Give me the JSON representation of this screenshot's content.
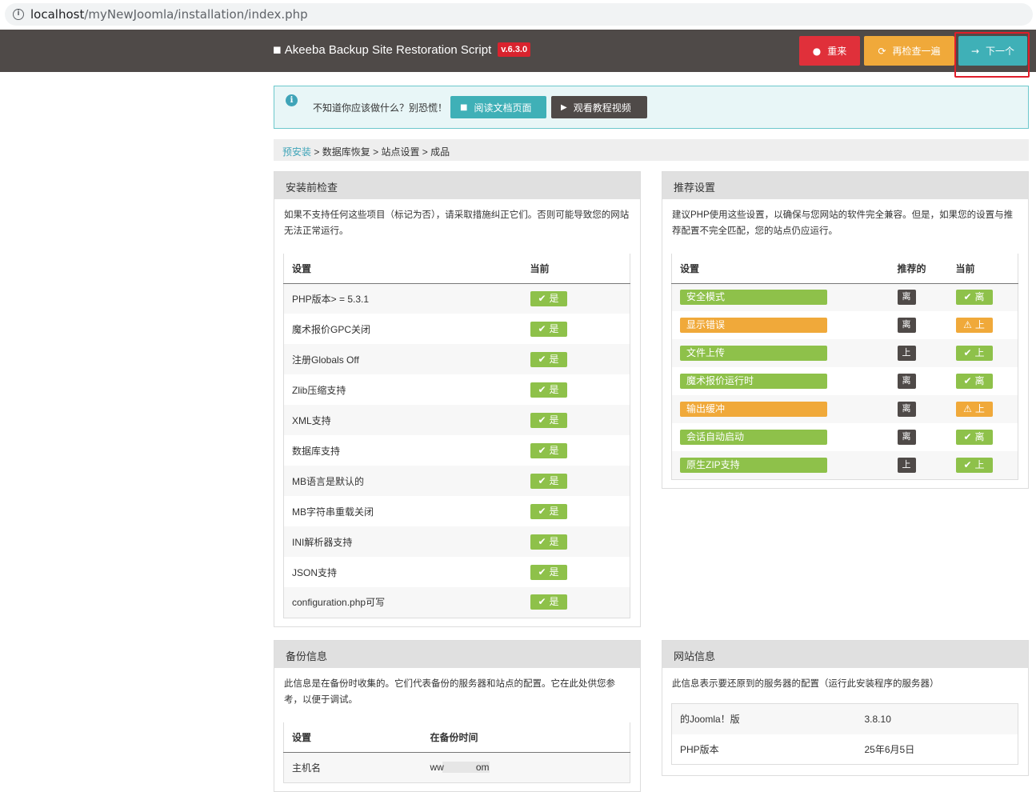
{
  "browser": {
    "url_host": "localhost",
    "url_path": "/myNewJoomla/installation/index.php"
  },
  "header": {
    "title": "Akeeba Backup Site Restoration Script",
    "version": "v.6.3.0",
    "buttons": {
      "reset": "重来",
      "recheck": "再检查一遍",
      "next": "下一个"
    }
  },
  "alert": {
    "text": "不知道你应该做什么？别恐慌！",
    "docs": "阅读文档页面",
    "video": "观看教程视频"
  },
  "breadcrumb": {
    "items": [
      "预安装",
      "数据库恢复",
      "站点设置",
      "成品"
    ],
    "separator": ">"
  },
  "precheck": {
    "title": "安装前检查",
    "description": "如果不支持任何这些项目（标记为否），请采取措施纠正它们。否则可能导致您的网站无法正常运行。",
    "col_setting": "设置",
    "col_current": "当前",
    "rows": [
      {
        "name": "PHP版本> = 5.3.1",
        "value": "是"
      },
      {
        "name": "魔术报价GPC关闭",
        "value": "是"
      },
      {
        "name": "注册Globals Off",
        "value": "是"
      },
      {
        "name": "Zlib压缩支持",
        "value": "是"
      },
      {
        "name": "XML支持",
        "value": "是"
      },
      {
        "name": "数据库支持",
        "value": "是"
      },
      {
        "name": "MB语言是默认的",
        "value": "是"
      },
      {
        "name": "MB字符串重载关闭",
        "value": "是"
      },
      {
        "name": "INI解析器支持",
        "value": "是"
      },
      {
        "name": "JSON支持",
        "value": "是"
      },
      {
        "name": "configuration.php可写",
        "value": "是"
      }
    ]
  },
  "recommended": {
    "title": "推荐设置",
    "description": "建议PHP使用这些设置，以确保与您网站的软件完全兼容。但是，如果您的设置与推荐配置不完全匹配，您的站点仍应运行。",
    "col_setting": "设置",
    "col_recommended": "推荐的",
    "col_current": "当前",
    "rows": [
      {
        "name": "安全模式",
        "recommended": "离",
        "current": "离",
        "status": "ok",
        "color": "#8ec14a"
      },
      {
        "name": "显示错误",
        "recommended": "离",
        "current": "上",
        "status": "warn",
        "color": "#f0a93a"
      },
      {
        "name": "文件上传",
        "recommended": "上",
        "current": "上",
        "status": "ok",
        "color": "#8ec14a"
      },
      {
        "name": "魔术报价运行时",
        "recommended": "离",
        "current": "离",
        "status": "ok",
        "color": "#8ec14a"
      },
      {
        "name": "输出缓冲",
        "recommended": "离",
        "current": "上",
        "status": "warn",
        "color": "#f0a93a"
      },
      {
        "name": "会话自动启动",
        "recommended": "离",
        "current": "离",
        "status": "ok",
        "color": "#8ec14a"
      },
      {
        "name": "原生ZIP支持",
        "recommended": "上",
        "current": "上",
        "status": "ok",
        "color": "#8ec14a"
      }
    ]
  },
  "backup_info": {
    "title": "备份信息",
    "description": "此信息是在备份时收集的。它们代表备份的服务器和站点的配置。它在此处供您参考，以便于调试。",
    "col_setting": "设置",
    "col_time": "在备份时间",
    "rows": [
      {
        "name": "主机名",
        "value": "ww            om"
      }
    ]
  },
  "site_info": {
    "title": "网站信息",
    "description": "此信息表示要还原到的服务器的配置（运行此安装程序的服务器）",
    "rows": [
      {
        "name": "的Joomla！版",
        "value": "3.8.10"
      },
      {
        "name": "PHP版本",
        "value": "25年6月5日"
      }
    ]
  },
  "colors": {
    "header": "#4f4a48",
    "teal": "#3fb0b7",
    "red": "#e0303a",
    "orange": "#f0a93a",
    "green": "#8ec14a"
  }
}
